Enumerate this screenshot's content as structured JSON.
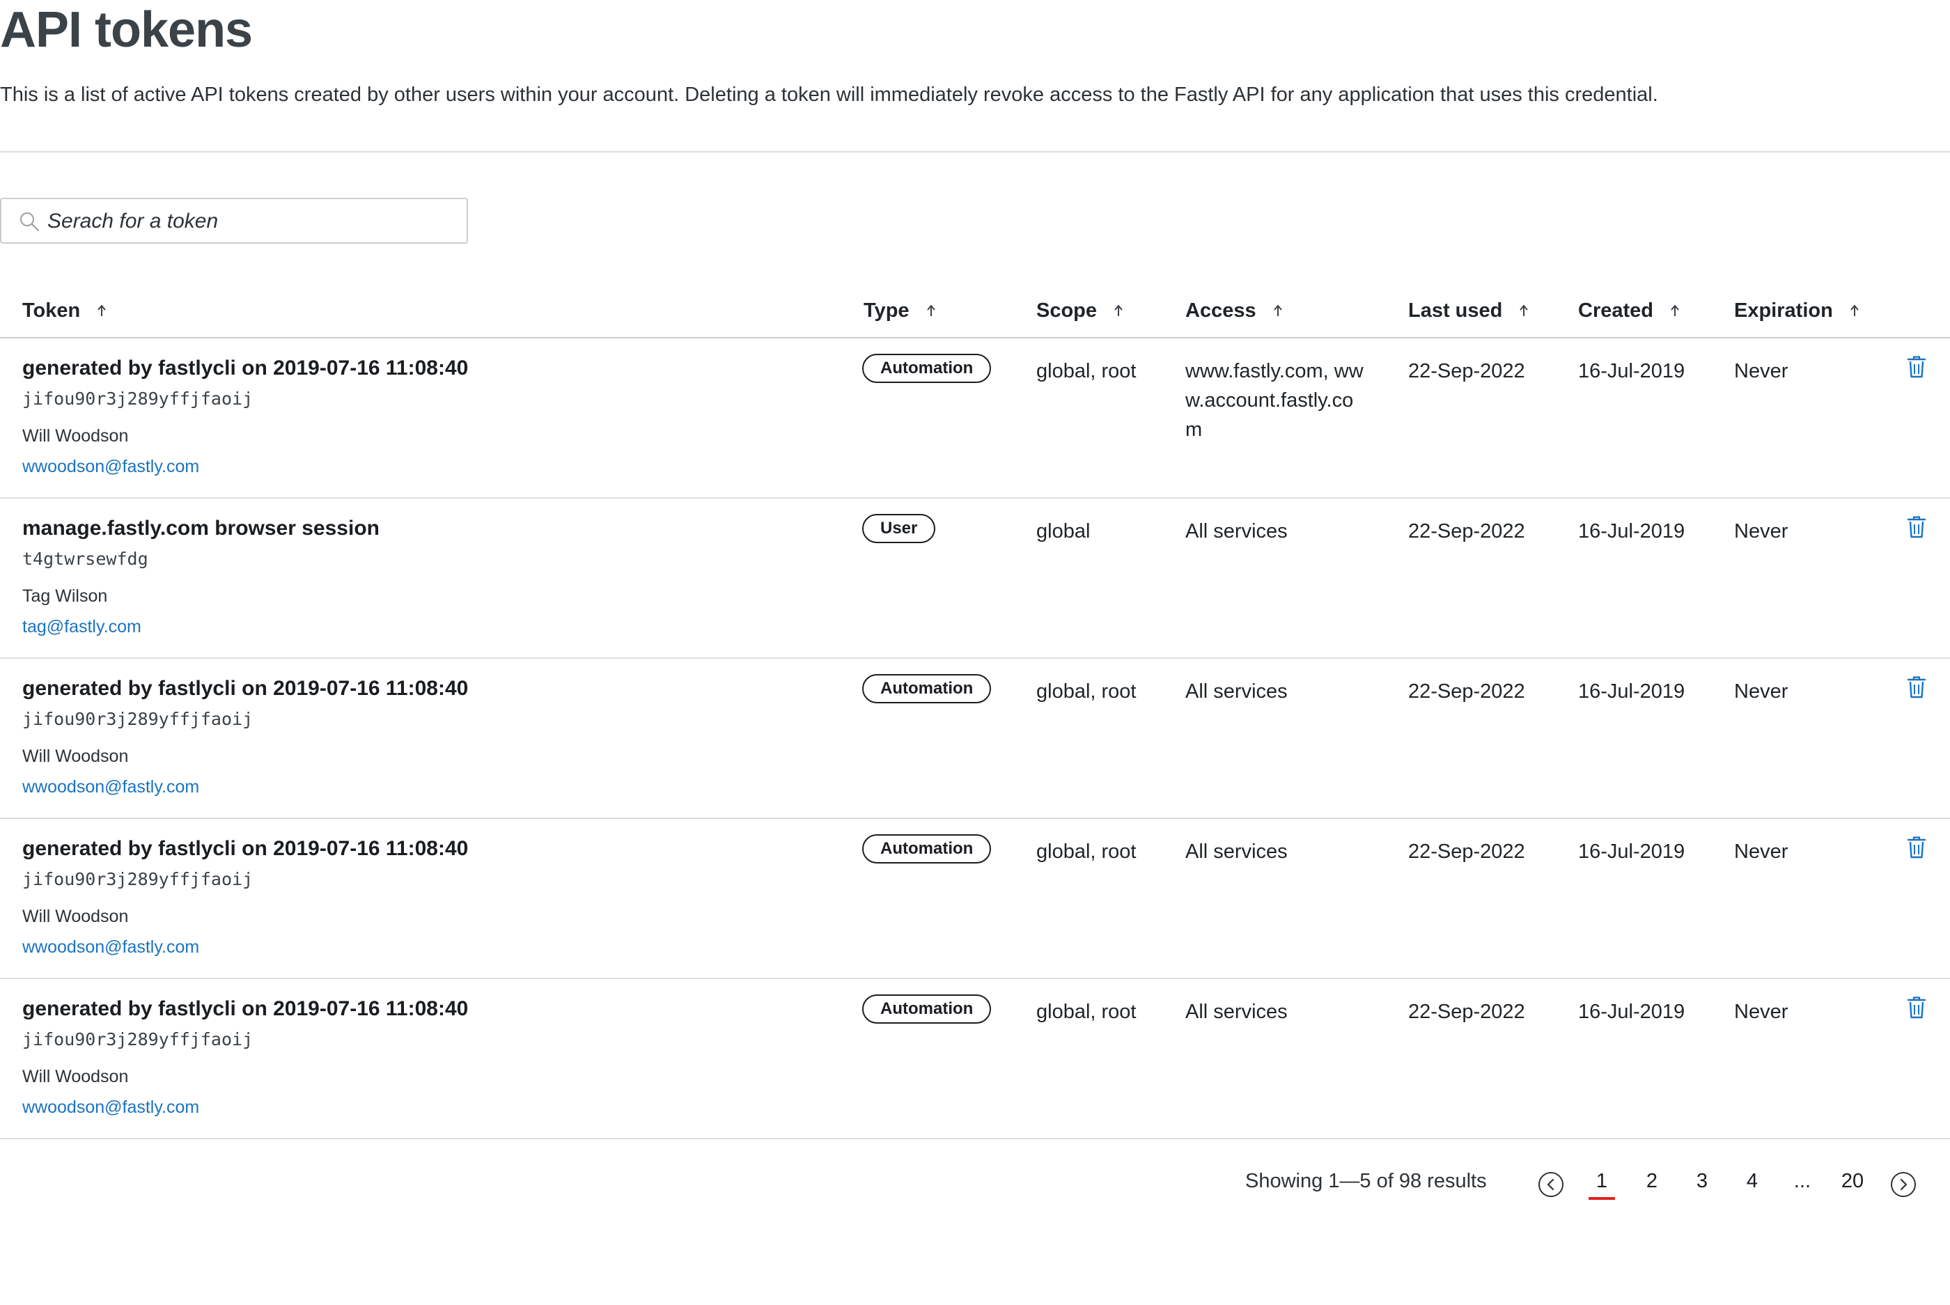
{
  "page": {
    "title": "API tokens",
    "description": "This is a list of active API tokens created by other users within your account. Deleting a token will immediately revoke access to the Fastly API for any application that uses this credential."
  },
  "search": {
    "placeholder": "Serach for a token"
  },
  "table": {
    "columns": {
      "token": "Token",
      "type": "Type",
      "scope": "Scope",
      "access": "Access",
      "last_used": "Last used",
      "created": "Created",
      "expiration": "Expiration"
    },
    "rows": [
      {
        "name": "generated by fastlycli on 2019-07-16 11:08:40",
        "id": "jifou90r3j289yffjfaoij",
        "user": "Will Woodson",
        "email": "wwoodson@fastly.com",
        "type": "Automation",
        "scope": "global, root",
        "access": "www.fastly.com, www.account.fastly.com",
        "last_used": "22-Sep-2022",
        "created": "16-Jul-2019",
        "expiration": "Never"
      },
      {
        "name": "manage.fastly.com browser session",
        "id": "t4gtwrsewfdg",
        "user": "Tag Wilson",
        "email": "tag@fastly.com",
        "type": "User",
        "scope": "global",
        "access": "All services",
        "last_used": "22-Sep-2022",
        "created": "16-Jul-2019",
        "expiration": "Never"
      },
      {
        "name": "generated by fastlycli on 2019-07-16 11:08:40",
        "id": "jifou90r3j289yffjfaoij",
        "user": "Will Woodson",
        "email": "wwoodson@fastly.com",
        "type": "Automation",
        "scope": "global, root",
        "access": "All services",
        "last_used": "22-Sep-2022",
        "created": "16-Jul-2019",
        "expiration": "Never"
      },
      {
        "name": "generated by fastlycli on 2019-07-16 11:08:40",
        "id": "jifou90r3j289yffjfaoij",
        "user": "Will Woodson",
        "email": "wwoodson@fastly.com",
        "type": "Automation",
        "scope": "global, root",
        "access": "All services",
        "last_used": "22-Sep-2022",
        "created": "16-Jul-2019",
        "expiration": "Never"
      },
      {
        "name": "generated by fastlycli on 2019-07-16 11:08:40",
        "id": "jifou90r3j289yffjfaoij",
        "user": "Will Woodson",
        "email": "wwoodson@fastly.com",
        "type": "Automation",
        "scope": "global, root",
        "access": "All services",
        "last_used": "22-Sep-2022",
        "created": "16-Jul-2019",
        "expiration": "Never"
      }
    ]
  },
  "pagination": {
    "summary": "Showing 1—5 of 98 results",
    "pages": [
      "1",
      "2",
      "3",
      "4",
      "...",
      "20"
    ],
    "current_page": "1"
  },
  "colors": {
    "link": "#1a73c0",
    "delete_icon": "#1a73c0",
    "active_page_underline": "#e0201f"
  }
}
